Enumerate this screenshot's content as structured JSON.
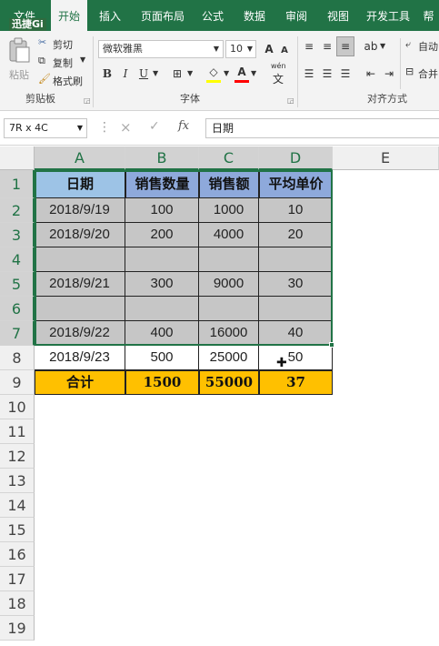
{
  "watermark": "迅捷Gi",
  "ribbon_tabs": [
    {
      "label": "文件",
      "active": false
    },
    {
      "label": "开始",
      "active": true
    },
    {
      "label": "插入",
      "active": false
    },
    {
      "label": "页面布局",
      "active": false
    },
    {
      "label": "公式",
      "active": false
    },
    {
      "label": "数据",
      "active": false
    },
    {
      "label": "审阅",
      "active": false
    },
    {
      "label": "视图",
      "active": false
    },
    {
      "label": "开发工具",
      "active": false
    },
    {
      "label": "帮",
      "active": false
    }
  ],
  "clipboard": {
    "paste_label": "粘贴",
    "cut_label": "剪切",
    "copy_label": "复制",
    "format_painter_label": "格式刷",
    "group_label": "剪贴板"
  },
  "font": {
    "font_name": "微软雅黑",
    "font_size": "10",
    "bold": "B",
    "italic": "I",
    "underline": "U",
    "grow": "A",
    "shrink": "A",
    "phonetic": "wén",
    "font_color_label": "A",
    "fill_color": "#ffff00",
    "font_color": "#ff0000",
    "group_label": "字体"
  },
  "alignment": {
    "wrap_label": "自动",
    "merge_label": "合并",
    "group_label": "对齐方式"
  },
  "formula_bar": {
    "name_box": "7R x 4C",
    "cancel": "×",
    "enter": "✓",
    "fx": "fx",
    "content": "日期"
  },
  "columns": [
    "A",
    "B",
    "C",
    "D",
    "E"
  ],
  "rows": [
    "1",
    "2",
    "3",
    "4",
    "5",
    "6",
    "7",
    "8",
    "9",
    "10",
    "11",
    "12",
    "13",
    "14",
    "15",
    "16",
    "17",
    "18",
    "19"
  ],
  "table": {
    "headers": [
      "日期",
      "销售数量",
      "销售额",
      "平均单价"
    ],
    "data_rows": [
      [
        "2018/9/19",
        "100",
        "1000",
        "10"
      ],
      [
        "2018/9/20",
        "200",
        "4000",
        "20"
      ],
      [
        "",
        "",
        "",
        ""
      ],
      [
        "2018/9/21",
        "300",
        "9000",
        "30"
      ],
      [
        "",
        "",
        "",
        ""
      ],
      [
        "2018/9/22",
        "400",
        "16000",
        "40"
      ],
      [
        "2018/9/23",
        "500",
        "25000",
        "50"
      ]
    ],
    "totals": [
      "合计",
      "1500",
      "55000",
      "37"
    ]
  },
  "colors": {
    "accent": "#217346",
    "header_fill": "#9dc3e6",
    "header_fill_alt": "#8ea9db",
    "selected_fill": "#c6c6c6",
    "total_fill": "#ffc000"
  }
}
